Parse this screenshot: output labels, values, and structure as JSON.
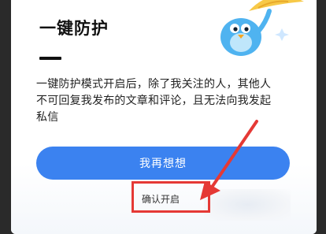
{
  "dialog": {
    "title": "一键防护",
    "description_lines": [
      "一键防护模式开启后，除了我关注的人，其他人",
      "不可回复我发布的文章和评论，且无法向我发起",
      "私信"
    ],
    "primary_button_label": "我再想想",
    "confirm_button_label": "确认开启"
  },
  "colors": {
    "primary": "#3b82f0",
    "highlight": "#e53935",
    "text": "#222222"
  }
}
